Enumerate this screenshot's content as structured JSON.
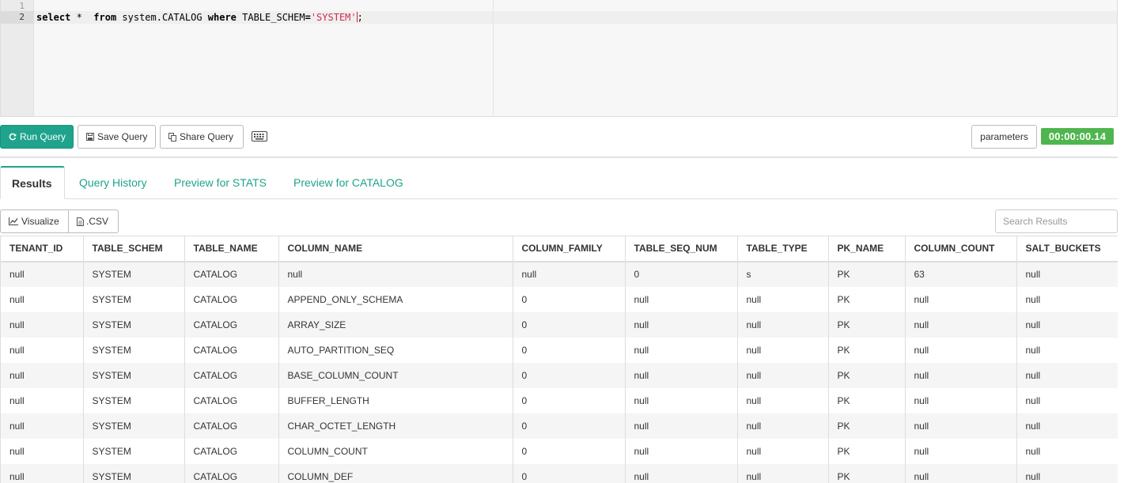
{
  "editor": {
    "line_numbers": [
      "1",
      "2"
    ],
    "query": {
      "kw_select": "select",
      "star": " *  ",
      "kw_from": "from",
      "table": " system.CATALOG ",
      "kw_where": "where",
      "column": " TABLE_SCHEM",
      "op": "=",
      "value": "'SYSTEM'",
      "semicolon": ";"
    }
  },
  "toolbar": {
    "run_label": "Run Query",
    "save_label": "Save Query",
    "share_label": "Share Query",
    "parameters_label": "parameters",
    "elapsed": "00:00:00.14"
  },
  "tabs": [
    "Results",
    "Query History",
    "Preview for STATS",
    "Preview for CATALOG"
  ],
  "results_toolbar": {
    "visualize_label": "Visualize",
    "csv_label": ".CSV",
    "search_placeholder": "Search Results"
  },
  "table": {
    "columns": [
      "TENANT_ID",
      "TABLE_SCHEM",
      "TABLE_NAME",
      "COLUMN_NAME",
      "COLUMN_FAMILY",
      "TABLE_SEQ_NUM",
      "TABLE_TYPE",
      "PK_NAME",
      "COLUMN_COUNT",
      "SALT_BUCKETS"
    ],
    "rows": [
      [
        "null",
        "SYSTEM",
        "CATALOG",
        "null",
        "null",
        "0",
        "s",
        "PK",
        "63",
        "null"
      ],
      [
        "null",
        "SYSTEM",
        "CATALOG",
        "APPEND_ONLY_SCHEMA",
        "0",
        "null",
        "null",
        "PK",
        "null",
        "null"
      ],
      [
        "null",
        "SYSTEM",
        "CATALOG",
        "ARRAY_SIZE",
        "0",
        "null",
        "null",
        "PK",
        "null",
        "null"
      ],
      [
        "null",
        "SYSTEM",
        "CATALOG",
        "AUTO_PARTITION_SEQ",
        "0",
        "null",
        "null",
        "PK",
        "null",
        "null"
      ],
      [
        "null",
        "SYSTEM",
        "CATALOG",
        "BASE_COLUMN_COUNT",
        "0",
        "null",
        "null",
        "PK",
        "null",
        "null"
      ],
      [
        "null",
        "SYSTEM",
        "CATALOG",
        "BUFFER_LENGTH",
        "0",
        "null",
        "null",
        "PK",
        "null",
        "null"
      ],
      [
        "null",
        "SYSTEM",
        "CATALOG",
        "CHAR_OCTET_LENGTH",
        "0",
        "null",
        "null",
        "PK",
        "null",
        "null"
      ],
      [
        "null",
        "SYSTEM",
        "CATALOG",
        "COLUMN_COUNT",
        "0",
        "null",
        "null",
        "PK",
        "null",
        "null"
      ],
      [
        "null",
        "SYSTEM",
        "CATALOG",
        "COLUMN_DEF",
        "0",
        "null",
        "null",
        "PK",
        "null",
        "null"
      ]
    ]
  },
  "colors": {
    "accent": "#1fa38c",
    "timer": "#4fb64f",
    "string_literal": "#d12a4f"
  }
}
